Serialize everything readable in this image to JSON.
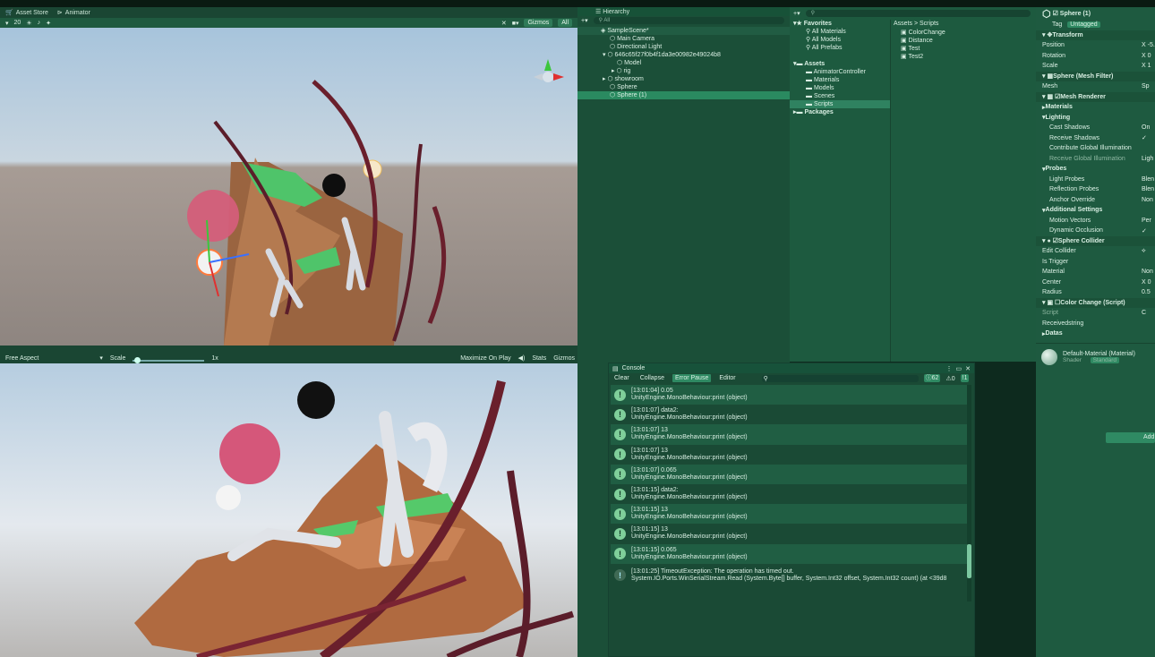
{
  "scene": {
    "tabs": [
      "Asset Store",
      "Animator"
    ],
    "toolbar": {
      "zoom": "20",
      "gizmos": "Gizmos",
      "search": "All"
    }
  },
  "game": {
    "aspect": "Free Aspect",
    "scale_label": "Scale",
    "scale_value": "1x",
    "maximize": "Maximize On Play",
    "stats": "Stats",
    "gizmos": "Gizmos"
  },
  "hierarchy": {
    "title": "Hierarchy",
    "search": "All",
    "items": [
      {
        "label": "SampleScene*",
        "depth": 0,
        "kind": "scene"
      },
      {
        "label": "Main Camera",
        "depth": 1
      },
      {
        "label": "Directional Light",
        "depth": 1
      },
      {
        "label": "646c65f27f0b4f1da3e00982e49024b8",
        "depth": 1
      },
      {
        "label": "Model",
        "depth": 2
      },
      {
        "label": "rig",
        "depth": 2
      },
      {
        "label": "showroom",
        "depth": 1
      },
      {
        "label": "Sphere",
        "depth": 1
      },
      {
        "label": "Sphere (1)",
        "depth": 1,
        "selected": true
      }
    ]
  },
  "project": {
    "breadcrumb": [
      "Assets",
      "Scripts"
    ],
    "tree": [
      {
        "label": "Favorites",
        "depth": 0,
        "bold": true
      },
      {
        "label": "All Materials",
        "depth": 1
      },
      {
        "label": "All Models",
        "depth": 1
      },
      {
        "label": "All Prefabs",
        "depth": 1
      },
      {
        "label": "",
        "depth": 0
      },
      {
        "label": "Assets",
        "depth": 0,
        "bold": true
      },
      {
        "label": "AnimatorController",
        "depth": 1
      },
      {
        "label": "Materials",
        "depth": 1
      },
      {
        "label": "Models",
        "depth": 1
      },
      {
        "label": "Scenes",
        "depth": 1
      },
      {
        "label": "Scripts",
        "depth": 1,
        "selected": true
      },
      {
        "label": "Packages",
        "depth": 0,
        "bold": true
      }
    ],
    "files": [
      "ColorChange",
      "Distance",
      "Test",
      "Test2"
    ]
  },
  "console": {
    "title": "Console",
    "buttons": [
      "Clear",
      "Collapse",
      "Error Pause",
      "Editor"
    ],
    "counts": {
      "logs": "62",
      "warnings": "0",
      "errors": "1"
    },
    "logs": [
      {
        "time": "[13:01:04] 0.05",
        "source": "UnityEngine.MonoBehaviour:print (object)"
      },
      {
        "time": "[13:01:07] data2:",
        "source": "UnityEngine.MonoBehaviour:print (object)"
      },
      {
        "time": "[13:01:07] 13",
        "source": "UnityEngine.MonoBehaviour:print (object)"
      },
      {
        "time": "[13:01:07] 13",
        "source": "UnityEngine.MonoBehaviour:print (object)"
      },
      {
        "time": "[13:01:07] 0.065",
        "source": "UnityEngine.MonoBehaviour:print (object)"
      },
      {
        "time": "[13:01:15] data2:",
        "source": "UnityEngine.MonoBehaviour:print (object)"
      },
      {
        "time": "[13:01:15] 13",
        "source": "UnityEngine.MonoBehaviour:print (object)"
      },
      {
        "time": "[13:01:15] 13",
        "source": "UnityEngine.MonoBehaviour:print (object)"
      },
      {
        "time": "[13:01:15] 0.065",
        "source": "UnityEngine.MonoBehaviour:print (object)"
      },
      {
        "time": "[13:01:25] TimeoutException: The operation has timed out.",
        "source": "System.IO.Ports.WinSerialStream.Read (System.Byte[] buffer, System.Int32 offset, System.Int32 count) (at <39d8",
        "error": true
      }
    ]
  },
  "inspector": {
    "object_name": "Sphere (1)",
    "tag_label": "Tag",
    "tag_value": "Untagged",
    "rows": [
      {
        "label": "Transform",
        "type": "section"
      },
      {
        "label": "Position",
        "value": "X -5."
      },
      {
        "label": "Rotation",
        "value": "X 0"
      },
      {
        "label": "Scale",
        "value": "X 1"
      },
      {
        "label": "Sphere (Mesh Filter)",
        "type": "section"
      },
      {
        "label": "Mesh",
        "value": "Sp"
      },
      {
        "label": "Mesh Renderer",
        "type": "section"
      },
      {
        "label": "Materials",
        "type": "group"
      },
      {
        "label": "Lighting",
        "type": "group"
      },
      {
        "label": "Cast Shadows",
        "value": "On",
        "sub": true
      },
      {
        "label": "Receive Shadows",
        "value": "✓",
        "sub": true
      },
      {
        "label": "Contribute Global Illumination",
        "value": "",
        "sub": true
      },
      {
        "label": "Receive Global Illumination",
        "value": "Ligh",
        "sub": true
      },
      {
        "label": "Probes",
        "type": "group"
      },
      {
        "label": "Light Probes",
        "value": "Blen",
        "sub": true
      },
      {
        "label": "Reflection Probes",
        "value": "Blen",
        "sub": true
      },
      {
        "label": "Anchor Override",
        "value": "Non",
        "sub": true
      },
      {
        "label": "Additional Settings",
        "type": "group"
      },
      {
        "label": "Motion Vectors",
        "value": "Per",
        "sub": true
      },
      {
        "label": "Dynamic Occlusion",
        "value": "✓",
        "sub": true
      },
      {
        "label": "Sphere Collider",
        "type": "section"
      },
      {
        "label": "Edit Collider",
        "value": ""
      },
      {
        "label": "Is Trigger",
        "value": ""
      },
      {
        "label": "Material",
        "value": "Non"
      },
      {
        "label": "Center",
        "value": "X 0"
      },
      {
        "label": "Radius",
        "value": "0.5"
      },
      {
        "label": "Color Change (Script)",
        "type": "section"
      },
      {
        "label": "Script",
        "value": "C"
      },
      {
        "label": "Receivedstring",
        "value": ""
      },
      {
        "label": "Datas",
        "type": "group"
      }
    ],
    "material_name": "Default-Material (Material)",
    "shader_label": "Shader",
    "shader_value": "Standard",
    "add_button": "Add"
  }
}
